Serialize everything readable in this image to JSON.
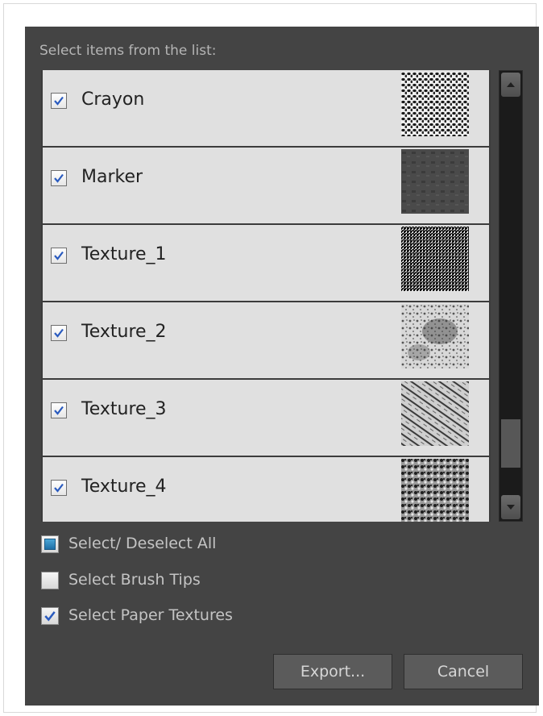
{
  "dialog": {
    "prompt": "Select items from the list:"
  },
  "list": {
    "items": [
      {
        "label": "Crayon",
        "checked": true,
        "thumbnail": "crayon-texture"
      },
      {
        "label": "Marker",
        "checked": true,
        "thumbnail": "marker-texture"
      },
      {
        "label": "Texture_1",
        "checked": true,
        "thumbnail": "texture-1"
      },
      {
        "label": "Texture_2",
        "checked": true,
        "thumbnail": "texture-2"
      },
      {
        "label": "Texture_3",
        "checked": true,
        "thumbnail": "texture-3"
      },
      {
        "label": "Texture_4",
        "checked": true,
        "thumbnail": "texture-4"
      }
    ]
  },
  "options": {
    "select_all": {
      "label": "Select/ Deselect All",
      "state": "partial"
    },
    "brush_tips": {
      "label": "Select Brush Tips",
      "checked": false
    },
    "paper_textures": {
      "label": "Select Paper Textures",
      "checked": true
    }
  },
  "buttons": {
    "export": "Export...",
    "cancel": "Cancel"
  },
  "colors": {
    "dialog_bg": "#444444",
    "list_item_bg": "#e0e0e0",
    "check_color": "#2a5bbf",
    "partial_fill": "#2b84bf"
  }
}
